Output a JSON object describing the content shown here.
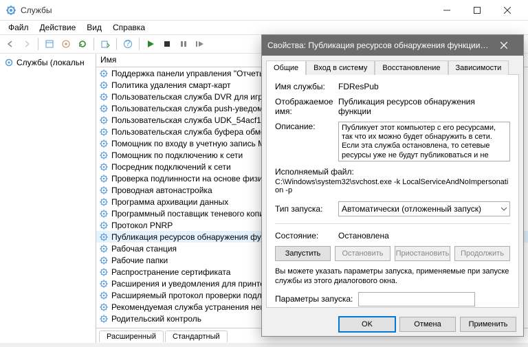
{
  "window": {
    "title": "Службы",
    "menu": [
      "Файл",
      "Действие",
      "Вид",
      "Справка"
    ]
  },
  "sidebar": {
    "root": "Службы (локальн"
  },
  "columns": {
    "name": "Имя"
  },
  "services": [
    "Поддержка панели управления \"Отчеты о проб…",
    "Политика удаления смарт-карт",
    "Пользовательская служба DVR для игр и транс…",
    "Пользовательская служба push-уведомлений …",
    "Пользовательская служба UDK_54acf1a",
    "Пользовательская служба буфера обмена_54ac…",
    "Помощник по входу в учетную запись Майкро…",
    "Помощник по подключению к сети",
    "Посредник подключений к сети",
    "Проверка подлинности на основе физических …",
    "Проводная автонастройка",
    "Программа архивации данных",
    "Программный поставщик теневого копирован…",
    "Протокол PNRP",
    "Публикация ресурсов обнаружения функции",
    "Рабочая станция",
    "Рабочие папки",
    "Распространение сертификата",
    "Расширения и уведомления для принтеров",
    "Расширяемый протокол проверки подлинност…",
    "Рекомендуемая служба устранения неполадо…",
    "Родительский контроль"
  ],
  "selected_index": 14,
  "bottom_tabs": {
    "ext": "Расширенный",
    "std": "Стандартный"
  },
  "dialog": {
    "title": "Свойства: Публикация ресурсов обнаружения функции (Локал…",
    "tabs": [
      "Общие",
      "Вход в систему",
      "Восстановление",
      "Зависимости"
    ],
    "labels": {
      "service_name": "Имя службы:",
      "display_name": "Отображаемое имя:",
      "description": "Описание:",
      "exe_label": "Исполняемый файл:",
      "startup_type": "Тип запуска:",
      "state": "Состояние:",
      "start_params": "Параметры запуска:"
    },
    "values": {
      "service_name": "FDResPub",
      "display_name": "Публикация ресурсов обнаружения функции",
      "description": "Публикует этот компьютер с его ресурсами, так что их можно будет обнаружить в сети. Если эта служба остановлена, то сетевые ресурсы уже не будут публиковаться и не будут",
      "exe_path": "C:\\Windows\\system32\\svchost.exe -k LocalServiceAndNoImpersonation -p",
      "startup_type": "Автоматически (отложенный запуск)",
      "state": "Остановлена"
    },
    "service_buttons": {
      "start": "Запустить",
      "stop": "Остановить",
      "pause": "Приостановить",
      "resume": "Продолжить"
    },
    "note": "Вы можете указать параметры запуска, применяемые при запуске службы из этого диалогового окна.",
    "footer": {
      "ok": "OK",
      "cancel": "Отмена",
      "apply": "Применить"
    }
  }
}
